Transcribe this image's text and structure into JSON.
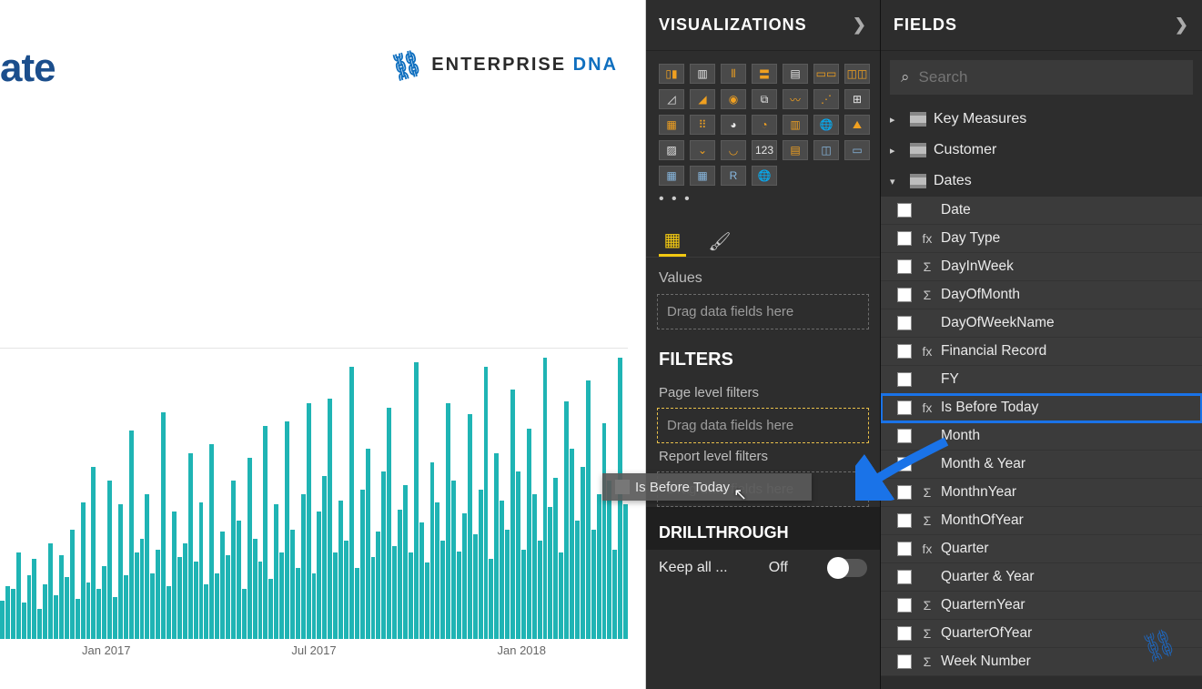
{
  "canvas": {
    "title_fragment": "ate",
    "logo_main": "ENTERPRISE",
    "logo_accent": "DNA"
  },
  "chart_data": {
    "type": "bar",
    "xlabel": "",
    "ylabel": "",
    "x_ticks": [
      "Jan 2017",
      "Jul 2017",
      "Jan 2018"
    ],
    "values": [
      42,
      58,
      55,
      95,
      40,
      70,
      88,
      33,
      60,
      105,
      48,
      92,
      68,
      120,
      44,
      150,
      62,
      190,
      55,
      80,
      175,
      46,
      148,
      70,
      230,
      95,
      110,
      160,
      72,
      98,
      250,
      58,
      140,
      90,
      105,
      205,
      85,
      150,
      60,
      215,
      72,
      118,
      92,
      175,
      130,
      55,
      200,
      110,
      85,
      235,
      66,
      148,
      95,
      240,
      120,
      78,
      160,
      260,
      72,
      140,
      180,
      265,
      95,
      152,
      108,
      300,
      78,
      165,
      210,
      90,
      118,
      185,
      255,
      102,
      142,
      170,
      95,
      305,
      128,
      84,
      195,
      150,
      108,
      260,
      175,
      96,
      138,
      248,
      115,
      165,
      300,
      88,
      205,
      152,
      120,
      275,
      185,
      98,
      232,
      160,
      108,
      310,
      145,
      178,
      95,
      262,
      210,
      130,
      190,
      285,
      120,
      160,
      238,
      175,
      98,
      310,
      148
    ],
    "ymax_relative": 320
  },
  "viz": {
    "header": "VISUALIZATIONS",
    "tabs": {
      "fields": "fields",
      "format": "format"
    },
    "values_label": "Values",
    "values_placeholder": "Drag data fields here"
  },
  "filters": {
    "header": "FILTERS",
    "page_label": "Page level filters",
    "page_placeholder": "Drag data fields here",
    "report_label": "Report level filters",
    "report_placeholder": "Drag data fields here",
    "drag_item": "Is Before Today"
  },
  "drill": {
    "header": "DRILLTHROUGH",
    "keep_label": "Keep all ...",
    "keep_state": "Off"
  },
  "fields": {
    "header": "FIELDS",
    "search_placeholder": "Search",
    "tables": [
      {
        "name": "Key Measures",
        "expanded": false
      },
      {
        "name": "Customer",
        "expanded": false
      },
      {
        "name": "Dates",
        "expanded": true
      }
    ],
    "date_fields": [
      {
        "name": "Date",
        "icon": ""
      },
      {
        "name": "Day Type",
        "icon": "fx"
      },
      {
        "name": "DayInWeek",
        "icon": "Σ"
      },
      {
        "name": "DayOfMonth",
        "icon": "Σ"
      },
      {
        "name": "DayOfWeekName",
        "icon": ""
      },
      {
        "name": "Financial Record",
        "icon": "fx"
      },
      {
        "name": "FY",
        "icon": ""
      },
      {
        "name": "Is Before Today",
        "icon": "fx",
        "highlight": true
      },
      {
        "name": "Month",
        "icon": ""
      },
      {
        "name": "Month & Year",
        "icon": ""
      },
      {
        "name": "MonthnYear",
        "icon": "Σ"
      },
      {
        "name": "MonthOfYear",
        "icon": "Σ"
      },
      {
        "name": "Quarter",
        "icon": "fx"
      },
      {
        "name": "Quarter & Year",
        "icon": ""
      },
      {
        "name": "QuarternYear",
        "icon": "Σ"
      },
      {
        "name": "QuarterOfYear",
        "icon": "Σ"
      },
      {
        "name": "Week Number",
        "icon": "Σ"
      }
    ]
  }
}
